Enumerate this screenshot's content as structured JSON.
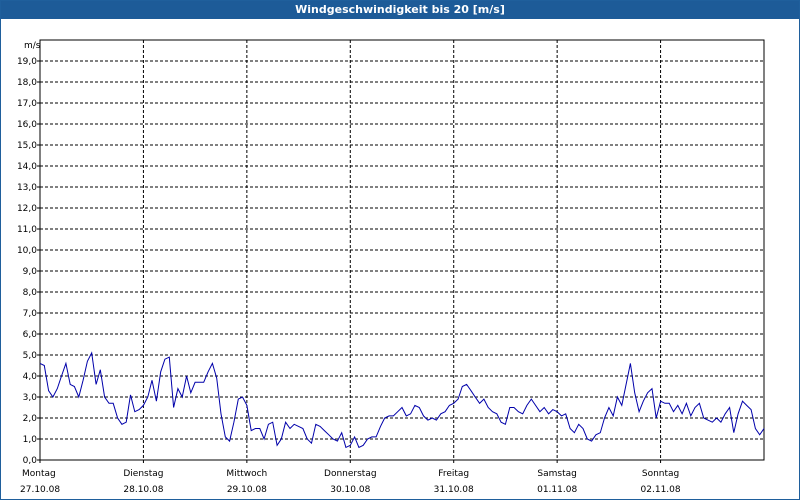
{
  "window": {
    "title": "Windgeschwindigkeit bis 20 [m/s]"
  },
  "chart_data": {
    "type": "line",
    "title": "Windgeschwindigkeit bis 20 [m/s]",
    "ylabel": "m/s",
    "ylim": [
      0,
      20
    ],
    "yticks": [
      "0,0",
      "1,0",
      "2,0",
      "3,0",
      "4,0",
      "5,0",
      "6,0",
      "7,0",
      "8,0",
      "9,0",
      "10,0",
      "11,0",
      "12,0",
      "13,0",
      "14,0",
      "15,0",
      "16,0",
      "17,0",
      "18,0",
      "19,0"
    ],
    "x_range_days": [
      0,
      7
    ],
    "day_ticks": [
      {
        "day": "Montag",
        "date": "27.10.08"
      },
      {
        "day": "Dienstag",
        "date": "28.10.08"
      },
      {
        "day": "Mittwoch",
        "date": "29.10.08"
      },
      {
        "day": "Donnerstag",
        "date": "30.10.08"
      },
      {
        "day": "Freitag",
        "date": "31.10.08"
      },
      {
        "day": "Samstag",
        "date": "01.11.08"
      },
      {
        "day": "Sonntag",
        "date": "02.11.08"
      }
    ],
    "grid": true,
    "line_color": "#0000aa",
    "series": [
      {
        "x": [
          0,
          0.042,
          0.083,
          0.125,
          0.167,
          0.208,
          0.25,
          0.292,
          0.333,
          0.375,
          0.417,
          0.458,
          0.5,
          0.542,
          0.583,
          0.625,
          0.667,
          0.708,
          0.75,
          0.792,
          0.833,
          0.875,
          0.917,
          0.958,
          1,
          1.042,
          1.083,
          1.125,
          1.167,
          1.208,
          1.25,
          1.292,
          1.333,
          1.375,
          1.417,
          1.458,
          1.5,
          1.542,
          1.583,
          1.625,
          1.667,
          1.708,
          1.75,
          1.792,
          1.833,
          1.875,
          1.917,
          1.958,
          2,
          2.042,
          2.083,
          2.125,
          2.167,
          2.208,
          2.25,
          2.292,
          2.333,
          2.375,
          2.417,
          2.458,
          2.5,
          2.542,
          2.583,
          2.625,
          2.667,
          2.708,
          2.75,
          2.792,
          2.833,
          2.875,
          2.917,
          2.958,
          3,
          3.042,
          3.083,
          3.125,
          3.167,
          3.208,
          3.25,
          3.292,
          3.333,
          3.375,
          3.417,
          3.458,
          3.5,
          3.542,
          3.583,
          3.625,
          3.667,
          3.708,
          3.75,
          3.792,
          3.833,
          3.875,
          3.917,
          3.958,
          4,
          4.042,
          4.083,
          4.125,
          4.167,
          4.208,
          4.25,
          4.292,
          4.333,
          4.375,
          4.417,
          4.458,
          4.5,
          4.542,
          4.583,
          4.625,
          4.667,
          4.708,
          4.75,
          4.792,
          4.833,
          4.875,
          4.917,
          4.958,
          5,
          5.042,
          5.083,
          5.125,
          5.167,
          5.208,
          5.25,
          5.292,
          5.333,
          5.375,
          5.417,
          5.458,
          5.5,
          5.542,
          5.583,
          5.625,
          5.667,
          5.708,
          5.75,
          5.792,
          5.833,
          5.875,
          5.917,
          5.958,
          6,
          6.042,
          6.083,
          6.125,
          6.167,
          6.208,
          6.25,
          6.292,
          6.333,
          6.375,
          6.417,
          6.458,
          6.5,
          6.542,
          6.583,
          6.625,
          6.667,
          6.708,
          6.75,
          6.792,
          6.833,
          6.875,
          6.917,
          6.958,
          7
        ],
        "values": [
          4.6,
          4.5,
          3.3,
          3.0,
          3.4,
          4.0,
          4.6,
          3.6,
          3.5,
          3.0,
          3.8,
          4.7,
          5.1,
          3.6,
          4.3,
          3.0,
          2.7,
          2.7,
          2.0,
          1.7,
          1.8,
          3.1,
          2.3,
          2.4,
          2.6,
          3.0,
          3.8,
          2.8,
          4.2,
          4.8,
          4.9,
          2.5,
          3.4,
          3.0,
          4.0,
          3.2,
          3.7,
          3.7,
          3.7,
          4.2,
          4.6,
          3.9,
          2.2,
          1.1,
          0.9,
          1.8,
          2.9,
          3.0,
          2.6,
          1.4,
          1.5,
          1.5,
          1.0,
          1.7,
          1.8,
          0.7,
          1.0,
          1.8,
          1.5,
          1.7,
          1.6,
          1.5,
          1.0,
          0.8,
          1.7,
          1.6,
          1.4,
          1.2,
          1.0,
          0.9,
          1.3,
          0.6,
          0.7,
          1.1,
          0.6,
          0.7,
          1.0,
          1.1,
          1.1,
          1.6,
          2.0,
          2.1,
          2.1,
          2.3,
          2.5,
          2.1,
          2.2,
          2.6,
          2.5,
          2.1,
          1.9,
          2.0,
          1.9,
          2.2,
          2.3,
          2.6,
          2.7,
          2.9,
          3.5,
          3.6,
          3.3,
          3.0,
          2.7,
          2.9,
          2.5,
          2.3,
          2.2,
          1.8,
          1.7,
          2.5,
          2.5,
          2.3,
          2.2,
          2.6,
          2.9,
          2.6,
          2.3,
          2.5,
          2.2,
          2.4,
          2.3,
          2.1,
          2.2,
          1.5,
          1.3,
          1.7,
          1.5,
          1.0,
          0.9,
          1.2,
          1.3,
          2.0,
          2.5,
          2.1,
          3.0,
          2.6,
          3.6,
          4.6,
          3.2,
          2.3,
          2.8,
          3.2,
          3.4,
          2.0,
          2.8,
          2.7,
          2.7,
          2.3,
          2.6,
          2.2,
          2.7,
          2.1,
          2.5,
          2.7,
          2.0,
          1.9,
          1.8,
          2.0,
          1.8,
          2.2,
          2.5,
          1.3,
          2.2,
          2.8,
          2.6,
          2.4,
          1.5,
          1.2,
          1.5
        ]
      }
    ]
  }
}
